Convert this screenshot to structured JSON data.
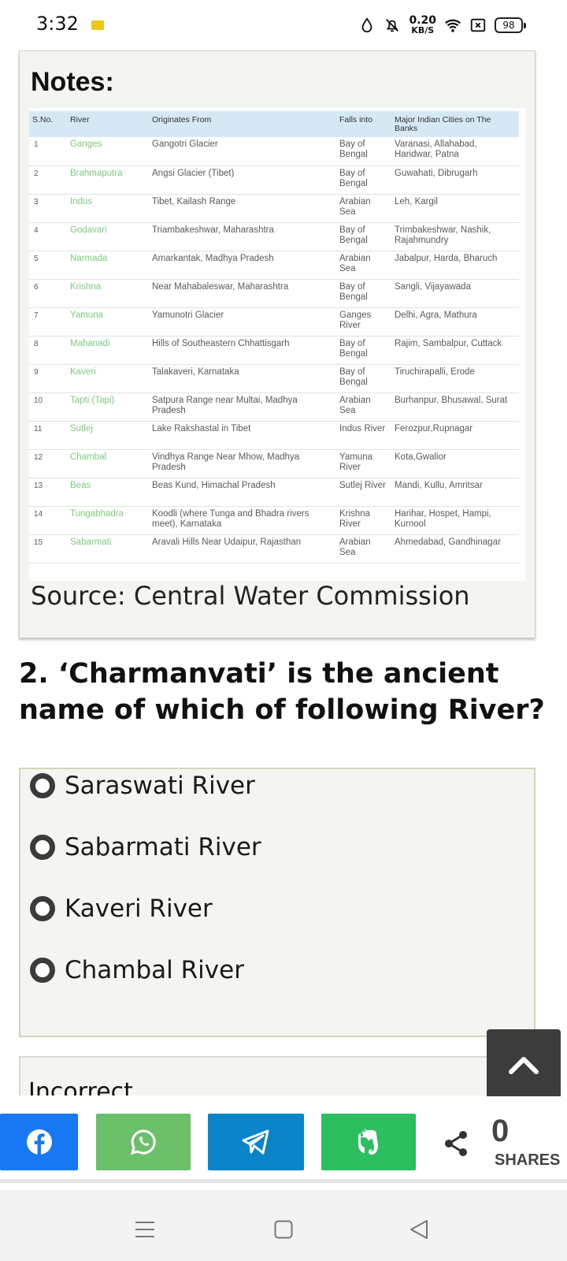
{
  "status_bar": {
    "time": "3:32",
    "speed_value": "0.20",
    "speed_unit": "KB/S",
    "battery": "98",
    "icons": [
      "notification-badge-icon",
      "water-drop-icon",
      "bell-off-icon",
      "wifi-icon",
      "sim-x-icon",
      "battery-icon"
    ]
  },
  "notes": {
    "title": "Notes:",
    "table": {
      "headers": [
        "S.No.",
        "River",
        "Originates From",
        "Falls into",
        "Major Indian Cities on The Banks"
      ],
      "rows": [
        [
          "1",
          "Ganges",
          "Gangotri Glacier",
          "Bay of Bengal",
          "Varanasi, Allahabad, Haridwar, Patna"
        ],
        [
          "2",
          "Brahmaputra",
          "Angsi Glacier (Tibet)",
          "Bay of Bengal",
          "Guwahati, Dibrugarh"
        ],
        [
          "3",
          "Indus",
          "Tibet, Kailash Range",
          "Arabian Sea",
          "Leh, Kargil"
        ],
        [
          "4",
          "Godavari",
          "Triambakeshwar, Maharashtra",
          "Bay of Bengal",
          "Trimbakeshwar, Nashik, Rajahmundry"
        ],
        [
          "5",
          "Narmada",
          "Amarkantak, Madhya Pradesh",
          "Arabian Sea",
          "Jabalpur, Harda, Bharuch"
        ],
        [
          "6",
          "Krishna",
          "Near Mahabaleswar, Maharashtra",
          "Bay of Bengal",
          "Sangli, Vijayawada"
        ],
        [
          "7",
          "Yamuna",
          "Yamunotri Glacier",
          "Ganges River",
          "Delhi, Agra, Mathura"
        ],
        [
          "8",
          "Mahanadi",
          "Hills of Southeastern Chhattisgarh",
          "Bay of Bengal",
          "Rajim, Sambalpur, Cuttack"
        ],
        [
          "9",
          "Kaveri",
          "Talakaveri, Karnataka",
          "Bay of Bengal",
          "Tiruchirapalli, Erode"
        ],
        [
          "10",
          "Tapti (Tapi)",
          "Satpura Range near Multai, Madhya Pradesh",
          "Arabian Sea",
          "Burhanpur, Bhusawal, Surat"
        ],
        [
          "11",
          "Sutlej",
          "Lake Rakshastal in Tibet",
          "Indus River",
          "Ferozpur,Rupnagar"
        ],
        [
          "12",
          "Chambal",
          "Vindhya Range Near Mhow, Madhya Pradesh",
          "Yamuna River",
          "Kota,Gwalior"
        ],
        [
          "13",
          "Beas",
          "Beas Kund, Himachal Pradesh",
          "Sutlej River",
          "Mandi, Kullu, Amritsar"
        ],
        [
          "14",
          "Tungabhadra",
          "Koodli (where Tunga and Bhadra rivers meet), Karnataka",
          "Krishna River",
          "Harihar, Hospet, Hampi, Kurnool"
        ],
        [
          "15",
          "Sabarmati",
          "Aravali Hills Near Udaipur, Rajasthan",
          "Arabian Sea",
          "Ahmedabad, Gandhinagar"
        ]
      ]
    },
    "source": "Source: Central Water Commission"
  },
  "question": {
    "text": "2. ‘Charmanvati’ is the ancient name of which of following River?",
    "options": [
      "Saraswati River",
      "Sabarmati River",
      "Kaveri River",
      "Chambal River"
    ]
  },
  "result": {
    "label": "Incorrect"
  },
  "share": {
    "buttons": [
      "facebook-icon",
      "whatsapp-icon",
      "telegram-icon",
      "evernote-icon"
    ],
    "colors": {
      "facebook": "#1877f2",
      "whatsapp": "#6cc06a",
      "telegram": "#0a84c9",
      "evernote": "#2dbe60"
    },
    "count": "0",
    "count_label": "SHARES"
  },
  "nav": [
    "menu-icon",
    "home-icon",
    "back-icon"
  ]
}
